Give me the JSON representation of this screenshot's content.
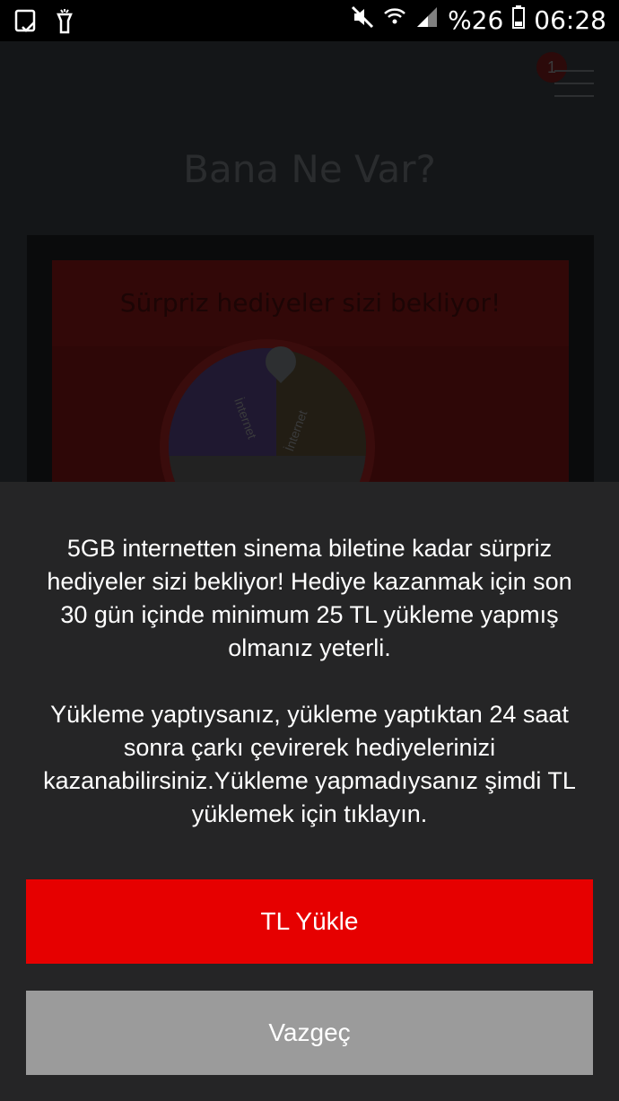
{
  "status_bar": {
    "left_icons": [
      "tablet-check-icon",
      "flashlight-icon"
    ],
    "right_icons": [
      "mute-icon",
      "wifi-icon",
      "signal-icon"
    ],
    "battery": "%26",
    "time": "06:28"
  },
  "background_page": {
    "notification_count": "1",
    "title": "Bana Ne Var?",
    "banner_text": "Sürpriz hediyeler sizi bekliyor!",
    "wheel_labels": [
      "İnternet",
      "İnternet"
    ]
  },
  "dialog": {
    "message_1": "5GB internetten sinema biletine kadar sürpriz hediyeler sizi bekliyor! Hediye kazanmak için son 30 gün içinde minimum 25 TL yükleme yapmış olmanız yeterli.",
    "message_2": "Yükleme yaptıysanız, yükleme yaptıktan 24 saat sonra çarkı çevirerek hediyelerinizi kazanabilirsiniz.Yükleme yapmadıysanız şimdi TL yüklemek için tıklayın.",
    "primary_button": "TL Yükle",
    "secondary_button": "Vazgeç"
  },
  "colors": {
    "primary": "#e60000",
    "secondary": "#9b9b9b",
    "dialog_bg": "#252526"
  }
}
